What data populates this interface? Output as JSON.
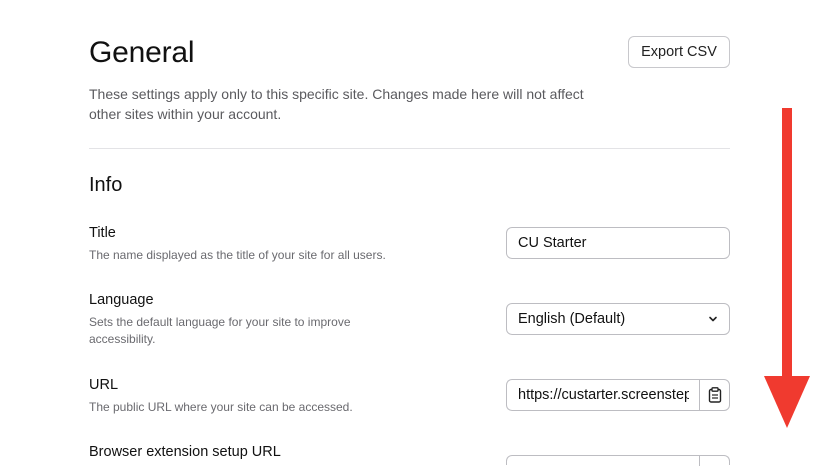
{
  "header": {
    "title": "General",
    "export_label": "Export CSV",
    "description": "These settings apply only to this specific site. Changes made here will not affect other sites within your account."
  },
  "section": {
    "title": "Info"
  },
  "rows": {
    "title": {
      "label": "Title",
      "help": "The name displayed as the title of your site for all users.",
      "value": "CU Starter"
    },
    "language": {
      "label": "Language",
      "help": "Sets the default language for your site to improve accessibility.",
      "value": "English (Default)"
    },
    "url": {
      "label": "URL",
      "help": "The public URL where your site can be accessed.",
      "value": "https://custarter.screenstep"
    },
    "extension": {
      "label": "Browser extension setup URL"
    }
  },
  "icons": {
    "select": "chevron-down-icon",
    "copy": "clipboard-icon",
    "annotation": "red-arrow-down"
  },
  "colors": {
    "arrow": "#f03a2f"
  }
}
